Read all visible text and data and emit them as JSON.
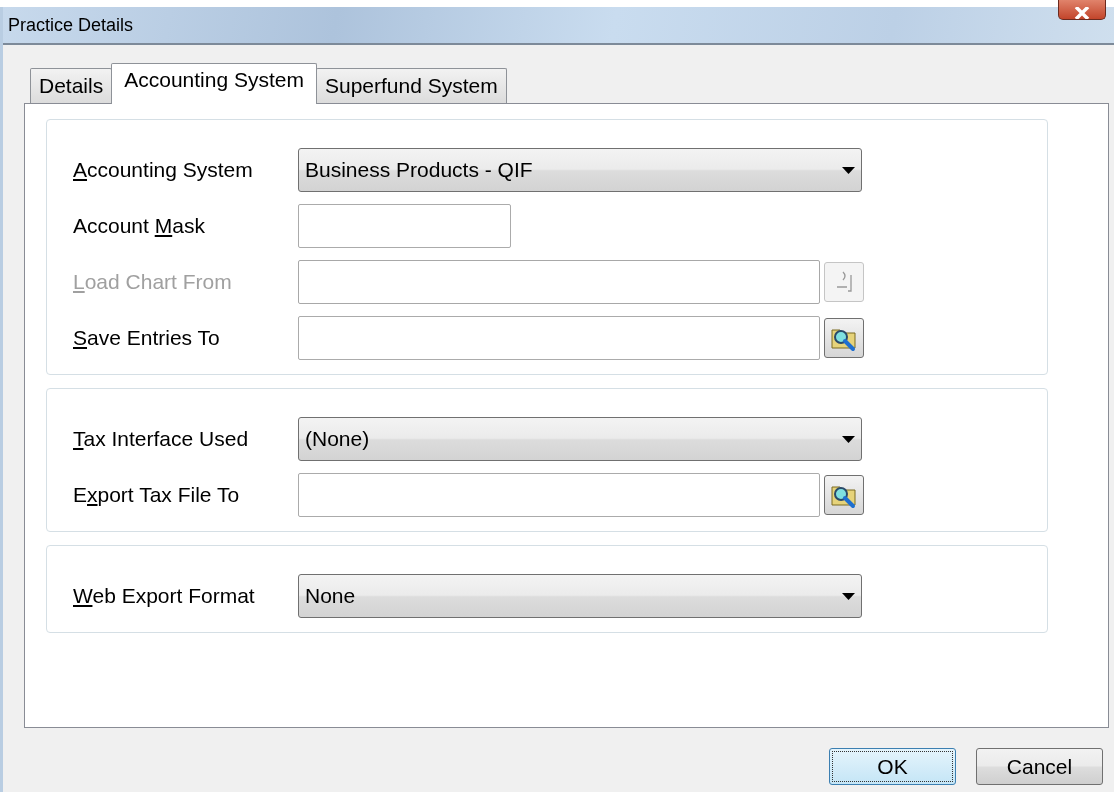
{
  "window": {
    "title": "Practice Details"
  },
  "tabs": [
    {
      "label": "Details",
      "selected": false
    },
    {
      "label": "Accounting System",
      "selected": true
    },
    {
      "label": "Superfund System",
      "selected": false
    }
  ],
  "groups": [
    {
      "rows": [
        {
          "kind": "dropdown",
          "label_parts": [
            {
              "text": "A",
              "hotkey": true
            },
            {
              "text": "ccounting System",
              "hotkey": false
            }
          ],
          "value": "Business Products - QIF",
          "disabled": false
        },
        {
          "kind": "short_text",
          "label_parts": [
            {
              "text": "Account ",
              "hotkey": false
            },
            {
              "text": "M",
              "hotkey": true
            },
            {
              "text": "ask",
              "hotkey": false
            }
          ],
          "disabled": false
        },
        {
          "kind": "browse",
          "label_parts": [
            {
              "text": "L",
              "hotkey": true
            },
            {
              "text": "oad Chart From",
              "hotkey": false
            }
          ],
          "disabled": true
        },
        {
          "kind": "browse",
          "label_parts": [
            {
              "text": "S",
              "hotkey": true
            },
            {
              "text": "ave Entries To",
              "hotkey": false
            }
          ],
          "disabled": false
        }
      ]
    },
    {
      "rows": [
        {
          "kind": "dropdown",
          "label_parts": [
            {
              "text": "T",
              "hotkey": true
            },
            {
              "text": "ax Interface Used",
              "hotkey": false
            }
          ],
          "value": "(None)",
          "disabled": false
        },
        {
          "kind": "browse",
          "label_parts": [
            {
              "text": "E",
              "hotkey": false
            },
            {
              "text": "x",
              "hotkey": true
            },
            {
              "text": "port Tax File To",
              "hotkey": false
            }
          ],
          "disabled": false
        }
      ]
    },
    {
      "rows": [
        {
          "kind": "dropdown",
          "label_parts": [
            {
              "text": "W",
              "hotkey": true
            },
            {
              "text": "eb Export Format",
              "hotkey": false
            }
          ],
          "value": "None",
          "disabled": false
        }
      ]
    }
  ],
  "buttons": [
    {
      "label": "OK",
      "default": true
    },
    {
      "label": "Cancel",
      "default": false
    }
  ]
}
